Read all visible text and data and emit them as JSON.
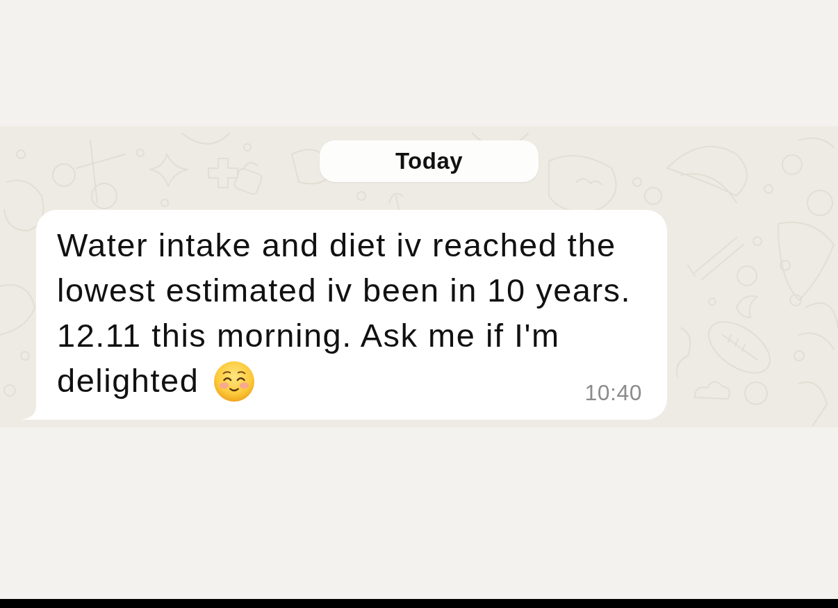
{
  "date_divider": {
    "label": "Today"
  },
  "messages": [
    {
      "kind": "incoming",
      "lines": [
        "Water intake and diet iv reached the",
        "lowest estimated iv been in 10 years.",
        "12.11 this morning. Ask me if I'm",
        "delighted"
      ],
      "time": "10:40"
    }
  ]
}
